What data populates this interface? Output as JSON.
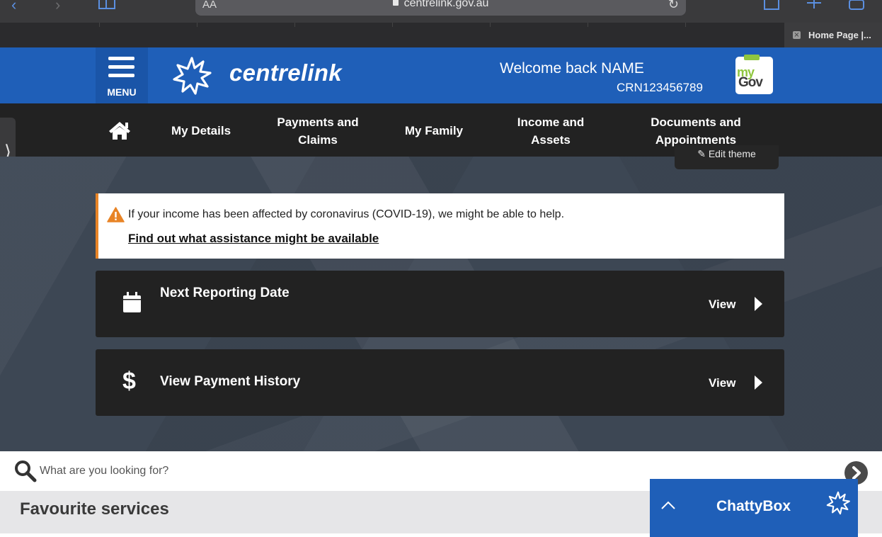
{
  "browser": {
    "text_size_label": "AA",
    "url": "centrelink.gov.au",
    "tab_title": "Home Page |...",
    "tab_close_glyph": "×"
  },
  "header": {
    "menu_label": "MENU",
    "brand": "centrelink",
    "welcome": "Welcome back NAME",
    "crn": "CRN123456789",
    "mygov_top": "my",
    "mygov_bottom": "Gov",
    "accent_color": "#1f5fb8"
  },
  "nav": {
    "items": [
      {
        "label": "My Details"
      },
      {
        "label": "Payments and Claims"
      },
      {
        "label": "My Family"
      },
      {
        "label": "Income and Assets"
      },
      {
        "label": "Documents and Appointments"
      }
    ],
    "side_tab_glyph": "⟩",
    "edit_theme_label": "✎ Edit theme"
  },
  "alert": {
    "message": "If your income has been affected by coronavirus (COVID-19), we might be able to help.",
    "link": "Find out what assistance might be available",
    "accent_color": "#e88426"
  },
  "cards": [
    {
      "title": "Next Reporting Date",
      "action": "View",
      "icon": "calendar-icon"
    },
    {
      "title": "View Payment History",
      "action": "View",
      "icon": "dollar-icon",
      "icon_glyph": "$"
    }
  ],
  "search": {
    "placeholder": "What are you looking for?"
  },
  "favourites": {
    "title": "Favourite services"
  },
  "chat": {
    "title": "ChattyBox"
  }
}
